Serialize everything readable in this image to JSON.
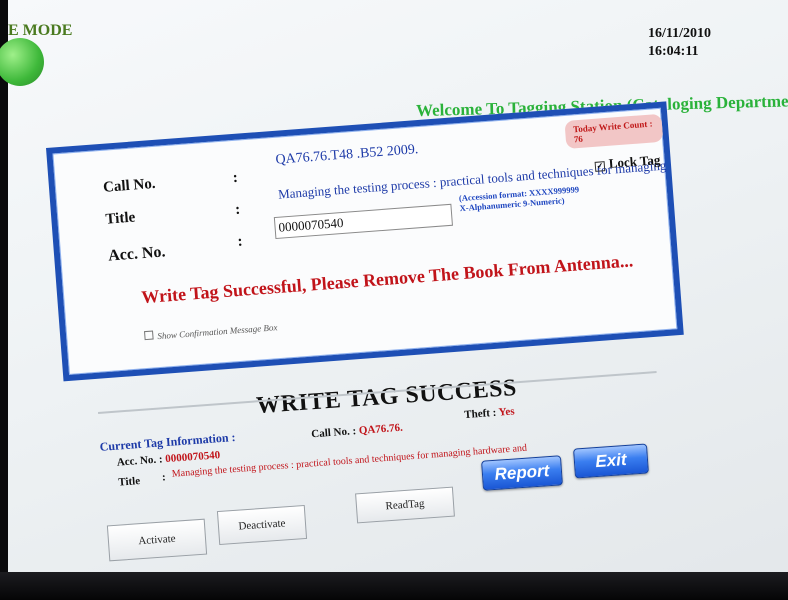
{
  "header": {
    "mode_label": "E MODE",
    "date": "16/11/2010",
    "time": "16:04:11",
    "welcome": "Welcome To Tagging Station (Cataloging Department)"
  },
  "panel": {
    "today_write_count": "Today Write Count : 76",
    "labels": {
      "call_no": "Call No.",
      "title": "Title",
      "acc_no": "Acc. No."
    },
    "colon": ":",
    "call_no_value": "QA76.76.T48 .B52 2009.",
    "title_value": "Managing the testing process : practical tools and techniques for managing",
    "lock_tag_label": "Lock Tag",
    "lock_tag_checked": true,
    "acc_no_value": "0000070540",
    "accession_format_line1": "(Accession format: XXXX999999",
    "accession_format_line2": "X-Alphanumeric 9-Numeric)",
    "status_message": "Write Tag Successful, Please Remove The Book From Antenna...",
    "show_confirmation_label": "Show Confirmation Message Box",
    "show_confirmation_checked": false
  },
  "result": {
    "heading": "WRITE TAG SUCCESS"
  },
  "current_tag": {
    "heading": "Current Tag Information :",
    "acc_label": "Acc. No. :",
    "acc_value": "0000070540",
    "call_label": "Call No. :",
    "call_value": "QA76.76.",
    "theft_label": "Theft :",
    "theft_value": "Yes",
    "title_label": "Title",
    "title_colon": ":",
    "title_value": "Managing the testing process : practical tools and techniques for managing hardware and"
  },
  "buttons": {
    "activate": "Activate",
    "deactivate": "Deactivate",
    "readtag": "ReadTag",
    "report": "Report",
    "exit": "Exit"
  },
  "colors": {
    "accent_blue": "#1e4fb5",
    "success_green": "#2ab23a",
    "error_red": "#c1141a"
  }
}
